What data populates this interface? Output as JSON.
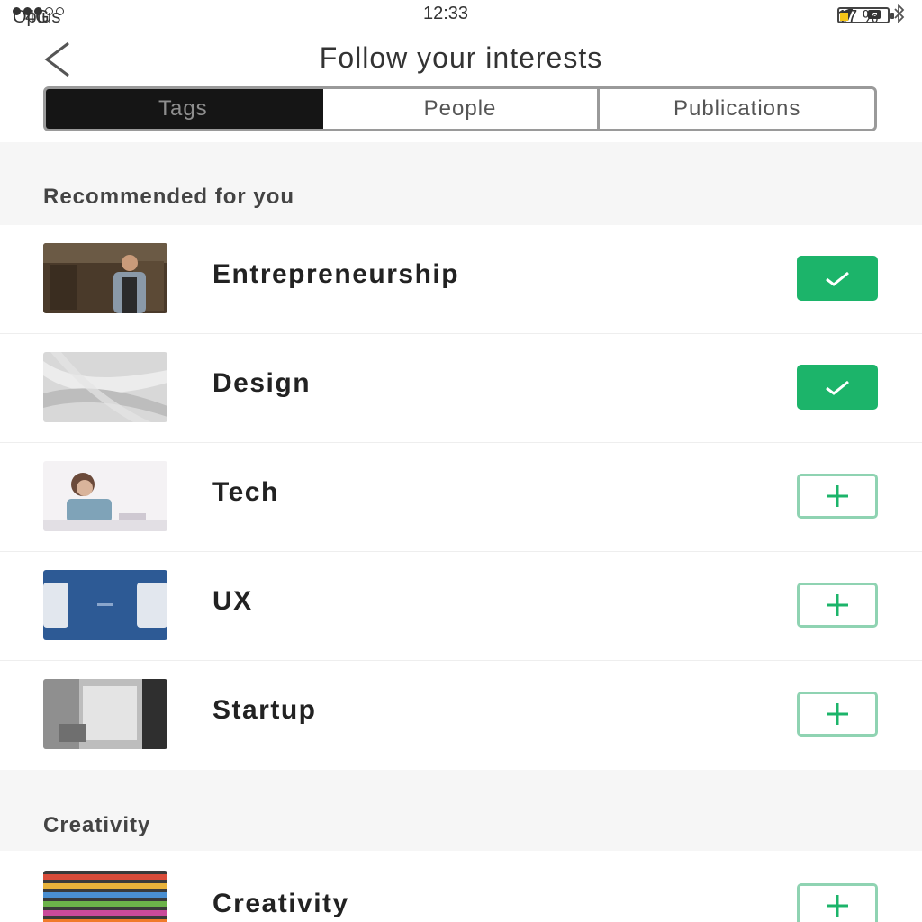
{
  "status_bar": {
    "carrier": "Optus",
    "network": "4G",
    "time": "12:33",
    "battery": "17 %",
    "battery_level": 0.17
  },
  "header": {
    "title": "Follow your interests"
  },
  "tabs": [
    {
      "label": "Tags",
      "active": true
    },
    {
      "label": "People",
      "active": false
    },
    {
      "label": "Publications",
      "active": false
    }
  ],
  "sections": [
    {
      "title": "Recommended for you",
      "items": [
        {
          "label": "Entrepreneurship",
          "following": true
        },
        {
          "label": "Design",
          "following": true
        },
        {
          "label": "Tech",
          "following": false
        },
        {
          "label": "UX",
          "following": false
        },
        {
          "label": "Startup",
          "following": false
        }
      ]
    },
    {
      "title": "Creativity",
      "items": [
        {
          "label": "Creativity",
          "following": false
        }
      ]
    }
  ],
  "colors": {
    "accent_green": "#1cb46a",
    "outline_green": "#8fd3b2",
    "active_tab": "#151515"
  },
  "icons": {
    "back": "chevron-left-icon",
    "followed": "check-icon",
    "follow": "plus-icon"
  }
}
